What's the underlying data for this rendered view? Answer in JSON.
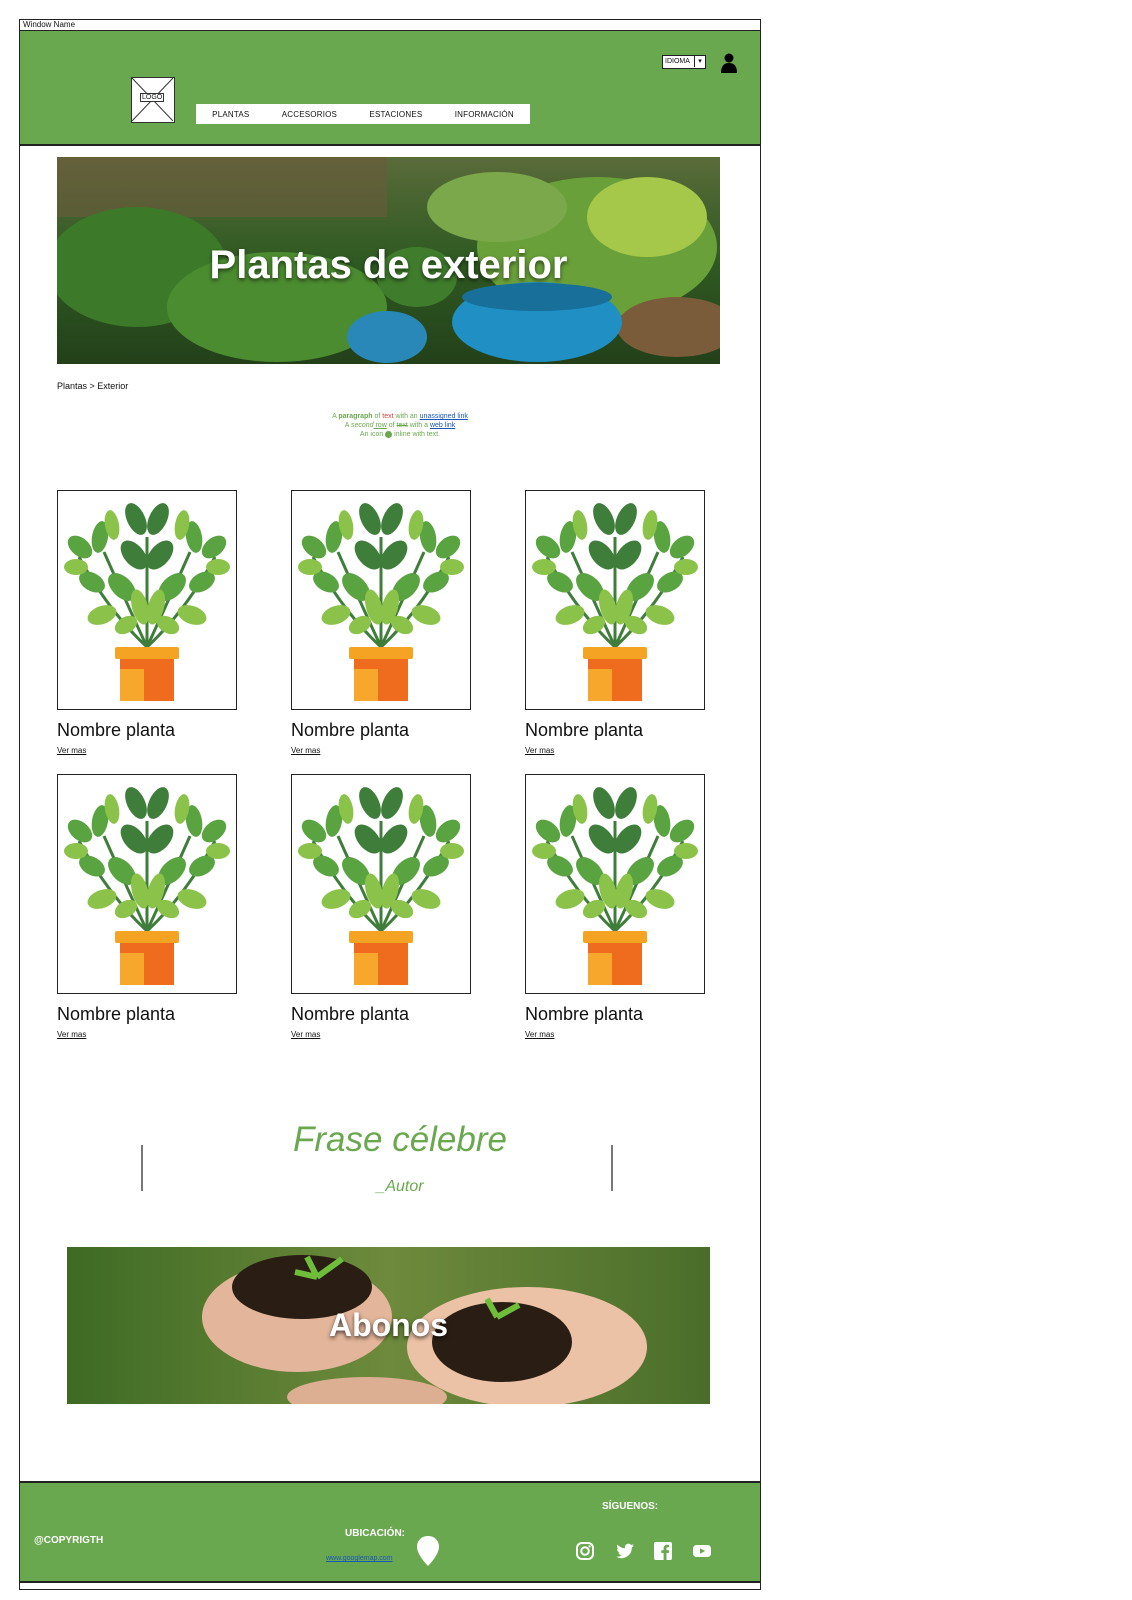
{
  "window": {
    "title": "Window Name"
  },
  "header": {
    "logo_text": "LOGO",
    "nav": [
      "PLANTAS",
      "ACCESORIOS",
      "ESTACIONES",
      "INFORMACIÓN"
    ],
    "language": "IDIOMA"
  },
  "hero": {
    "title": "Plantas de exterior"
  },
  "breadcrumb": "Plantas > Exterior",
  "paragraph": {
    "line1_a": "A ",
    "line1_b": "paragraph",
    "line1_c": " of ",
    "line1_d": "text",
    "line1_e": " with an ",
    "line1_link": "unassigned link",
    "line2_a": "A ",
    "line2_b": "second",
    "line2_c": " row",
    "line2_d": " of ",
    "line2_e": "text",
    "line2_f": " with a ",
    "line2_link": "web link",
    "line3_a": "An icon ",
    "line3_b": " inline with text."
  },
  "products": [
    {
      "name": "Nombre planta",
      "link": "Ver mas"
    },
    {
      "name": "Nombre planta",
      "link": "Ver mas"
    },
    {
      "name": "Nombre planta",
      "link": "Ver mas"
    },
    {
      "name": "Nombre planta",
      "link": "Ver mas"
    },
    {
      "name": "Nombre planta",
      "link": "Ver mas"
    },
    {
      "name": "Nombre planta",
      "link": "Ver mas"
    }
  ],
  "quote": {
    "text": "Frase célebre",
    "author": "_Autor"
  },
  "abonos": {
    "title": "Abonos"
  },
  "footer": {
    "copyright": "@COPYRIGTH",
    "location_title": "UBICACIÓN:",
    "location_link": "www.googlemap.com",
    "follow_title": "SÍGUENOS:"
  },
  "colors": {
    "brand_green": "#6aa84f",
    "link_blue": "#1a56b8",
    "pot_orange": "#f4a422"
  }
}
